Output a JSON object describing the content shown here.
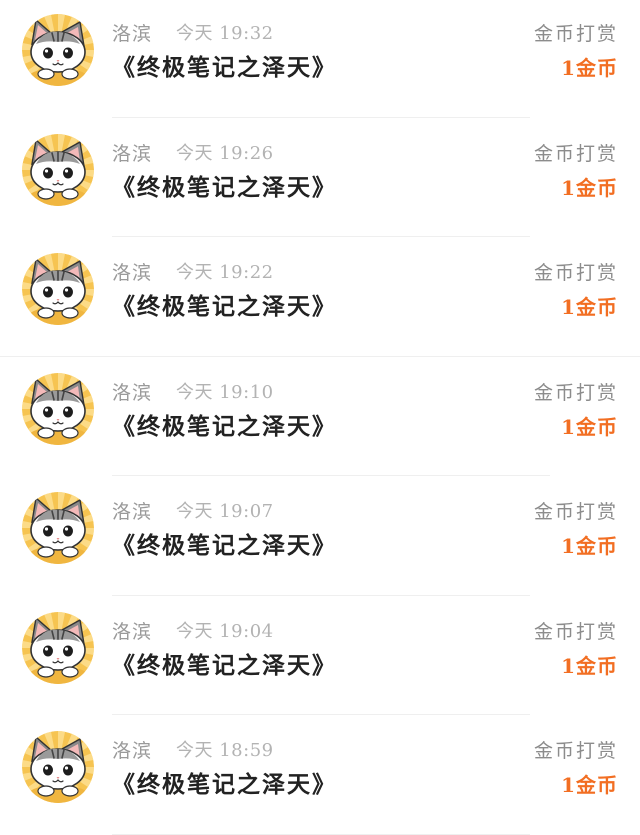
{
  "rewards": [
    {
      "user": "洛滨",
      "time": "今天 19:32",
      "book": "《终极笔记之泽天》",
      "type": "金币打赏",
      "amount": "1金币"
    },
    {
      "user": "洛滨",
      "time": "今天 19:26",
      "book": "《终极笔记之泽天》",
      "type": "金币打赏",
      "amount": "1金币"
    },
    {
      "user": "洛滨",
      "time": "今天 19:22",
      "book": "《终极笔记之泽天》",
      "type": "金币打赏",
      "amount": "1金币"
    },
    {
      "user": "洛滨",
      "time": "今天 19:10",
      "book": "《终极笔记之泽天》",
      "type": "金币打赏",
      "amount": "1金币"
    },
    {
      "user": "洛滨",
      "time": "今天 19:07",
      "book": "《终极笔记之泽天》",
      "type": "金币打赏",
      "amount": "1金币"
    },
    {
      "user": "洛滨",
      "time": "今天 19:04",
      "book": "《终极笔记之泽天》",
      "type": "金币打赏",
      "amount": "1金币"
    },
    {
      "user": "洛滨",
      "time": "今天 18:59",
      "book": "《终极笔记之泽天》",
      "type": "金币打赏",
      "amount": "1金币"
    }
  ],
  "avatar": {
    "icon": "cat-avatar-icon"
  },
  "colors": {
    "amount": "#f26e22",
    "name": "#9a9a9a",
    "time": "#b3b3b3",
    "book": "#222222",
    "avatar_bg": "#f6c451"
  }
}
